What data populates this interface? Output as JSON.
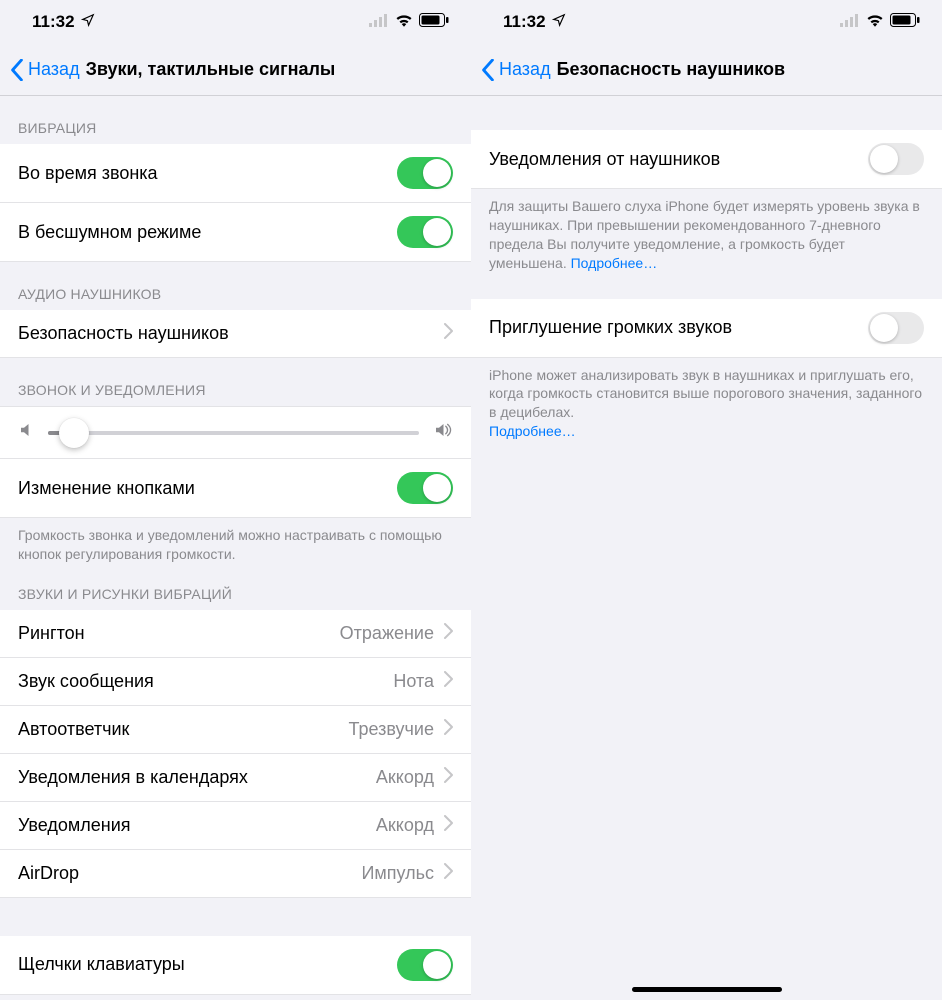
{
  "status": {
    "time": "11:32"
  },
  "left": {
    "back": "Назад",
    "title": "Звуки, тактильные сигналы",
    "sections": {
      "vibration": {
        "header": "ВИБРАЦИЯ",
        "rows": {
          "on_call": "Во время звонка",
          "on_silent": "В бесшумном режиме"
        },
        "on_call_enabled": true,
        "on_silent_enabled": true
      },
      "headphones_audio": {
        "header": "АУДИО НАУШНИКОВ",
        "row_safety": "Безопасность наушников"
      },
      "ringer": {
        "header": "ЗВОНОК И УВЕДОМЛЕНИЯ",
        "change_buttons": "Изменение кнопками",
        "change_buttons_enabled": true,
        "slider_percent": 7,
        "footer": "Громкость звонка и уведомлений можно настраивать с помощью кнопок регулирования громкости."
      },
      "sounds_patterns": {
        "header": "ЗВУКИ И РИСУНКИ ВИБРАЦИЙ",
        "rows": [
          {
            "label": "Рингтон",
            "value": "Отражение"
          },
          {
            "label": "Звук сообщения",
            "value": "Нота"
          },
          {
            "label": "Автоответчик",
            "value": "Трезвучие"
          },
          {
            "label": "Уведомления в календарях",
            "value": "Аккорд"
          },
          {
            "label": "Уведомления",
            "value": "Аккорд"
          },
          {
            "label": "AirDrop",
            "value": "Импульс"
          }
        ]
      },
      "keyboard_clicks": {
        "label": "Щелчки клавиатуры",
        "enabled": true
      }
    }
  },
  "right": {
    "back": "Назад",
    "title": "Безопасность наушников",
    "rows": {
      "notifications": {
        "label": "Уведомления от наушников",
        "enabled": false,
        "footer": "Для защиты Вашего слуха iPhone будет измерять уровень звука в наушниках. При превышении рекомендованного 7-дневного предела Вы получите уведомление, а громкость будет уменьшена.",
        "more": "Подробнее…"
      },
      "reduce_loud": {
        "label": "Приглушение громких звуков",
        "enabled": false,
        "footer": "iPhone может анализировать звук в наушниках и приглушать его, когда громкость становится выше порогового значения, заданного в децибелах.",
        "more": "Подробнее…"
      }
    }
  }
}
